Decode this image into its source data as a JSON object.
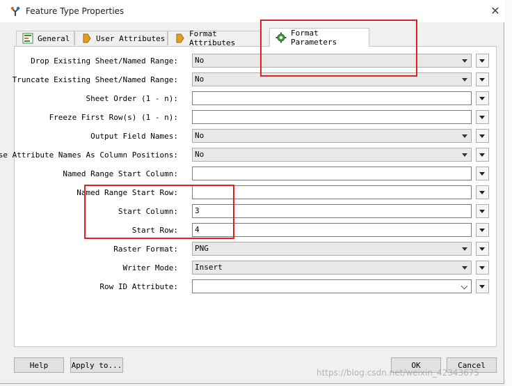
{
  "window": {
    "title": "Feature Type Properties"
  },
  "tabs": [
    {
      "label": "General",
      "icon": "general-icon"
    },
    {
      "label": "User Attributes",
      "icon": "tag-icon"
    },
    {
      "label": "Format Attributes",
      "icon": "tag-icon"
    },
    {
      "label": "Format Parameters",
      "icon": "gear-icon",
      "active": true
    }
  ],
  "params": [
    {
      "label": "Drop Existing Sheet/Named Range:",
      "value": "No"
    },
    {
      "label": "Truncate Existing Sheet/Named Range:",
      "value": "No"
    },
    {
      "label": "Sheet Order (1 - n):",
      "value": ""
    },
    {
      "label": "Freeze First Row(s) (1 - n):",
      "value": ""
    },
    {
      "label": "Output Field Names:",
      "value": "No"
    },
    {
      "label": "Use Attribute Names As Column Positions:",
      "value": "No"
    },
    {
      "label": "Named Range Start Column:",
      "value": ""
    },
    {
      "label": "Named Range Start Row:",
      "value": ""
    },
    {
      "label": "Start Column:",
      "value": "3"
    },
    {
      "label": "Start Row:",
      "value": "4"
    },
    {
      "label": "Raster Format:",
      "value": "PNG"
    },
    {
      "label": "Writer Mode:",
      "value": "Insert"
    },
    {
      "label": "Row ID Attribute:",
      "value": ""
    }
  ],
  "footer": {
    "help": "Help",
    "apply": "Apply to...",
    "ok": "OK",
    "cancel": "Cancel"
  },
  "watermark": "https://blog.csdn.net/weixin_42343675",
  "colors": {
    "highlight": "#e02020",
    "accent": "#1a73c8"
  }
}
